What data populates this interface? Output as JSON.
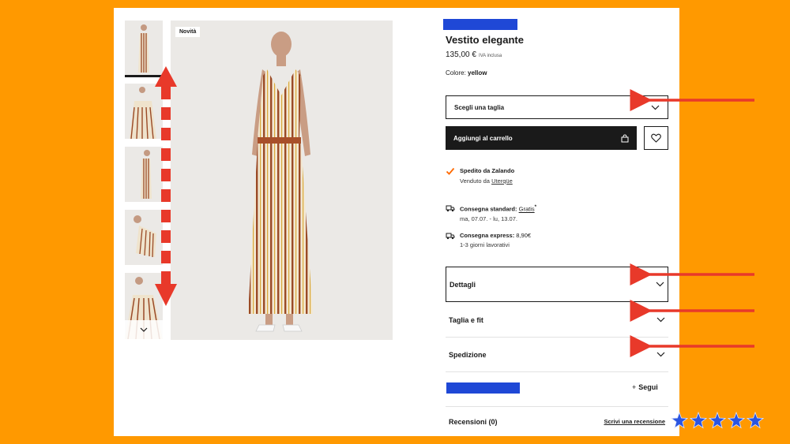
{
  "product": {
    "badge": "Novità",
    "title": "Vestito elegante",
    "price": "135,00 €",
    "vat": "IVA inclusa",
    "color_label": "Colore:",
    "color_value": "yellow"
  },
  "actions": {
    "size_select": "Scegli una taglia",
    "add_to_cart": "Aggiungi al carrello"
  },
  "shipping": {
    "shipped_by": "Spedito da Zalando",
    "sold_by_prefix": "Venduto da",
    "sold_by_name": "Uterqüe",
    "standard_label": "Consegna standard:",
    "standard_price": "Gratis",
    "standard_mark": "*",
    "standard_dates": "ma, 07.07. - lu, 13.07.",
    "express_label": "Consegna express:",
    "express_price": "8,90€",
    "express_dates": "1-3 giorni lavorativi"
  },
  "accordion": [
    "Dettagli",
    "Taglia e fit",
    "Spedizione"
  ],
  "brand": {
    "follow": "Segui"
  },
  "reviews": {
    "title": "Recensioni (0)",
    "write": "Scrivi una recensione"
  },
  "colors": {
    "accent": "#ff9900",
    "brand_block": "#1f48d6",
    "arrow": "#e8392a",
    "check": "#ff6900",
    "star": "#2b55e0"
  },
  "overlay": {
    "star_count": 5
  }
}
